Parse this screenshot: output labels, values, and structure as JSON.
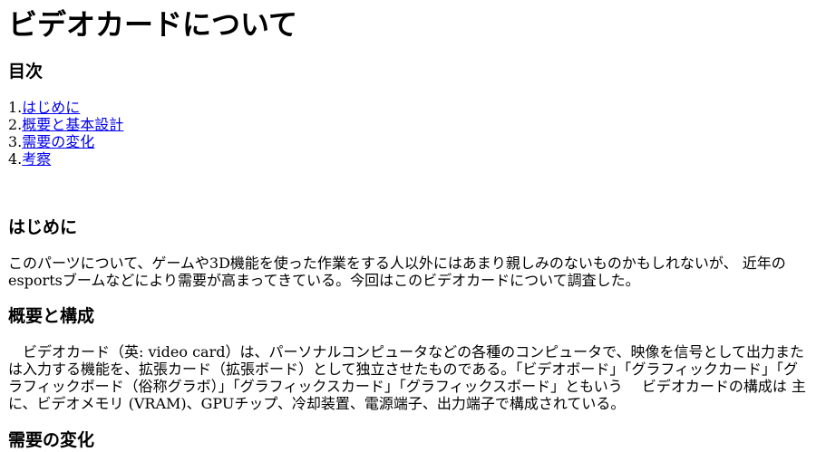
{
  "title": "ビデオカードについて",
  "toc": {
    "heading": "目次",
    "items": [
      {
        "number": "1.",
        "label": "はじめに"
      },
      {
        "number": "2.",
        "label": "概要と基本設計"
      },
      {
        "number": "3.",
        "label": "需要の変化"
      },
      {
        "number": "4.",
        "label": "考察"
      }
    ]
  },
  "sections": {
    "intro": {
      "heading": "はじめに",
      "text": "このパーツについて、ゲームや3D機能を使った作業をする人以外にはあまり親しみのないものかもしれないが、 近年のesportsブームなどにより需要が高まってきている。今回はこのビデオカードについて調査した。"
    },
    "overview": {
      "heading": "概要と構成",
      "text": "　ビデオカード（英: video card）は、パーソナルコンピュータなどの各種のコンピュータで、映像を信号として出力または入力する機能を、拡張カード（拡張ボード）として独立させたものである。「ビデオボード」「グラフィックカード」「グラフィックボード（俗称グラボ）」「グラフィックスカード」「グラフィックスボード」ともいう　 ビデオカードの構成は 主に、ビデオメモリ (VRAM)、GPUチップ、冷却装置、電源端子、出力端子で構成されている。"
    },
    "demand": {
      "heading": "需要の変化"
    }
  }
}
